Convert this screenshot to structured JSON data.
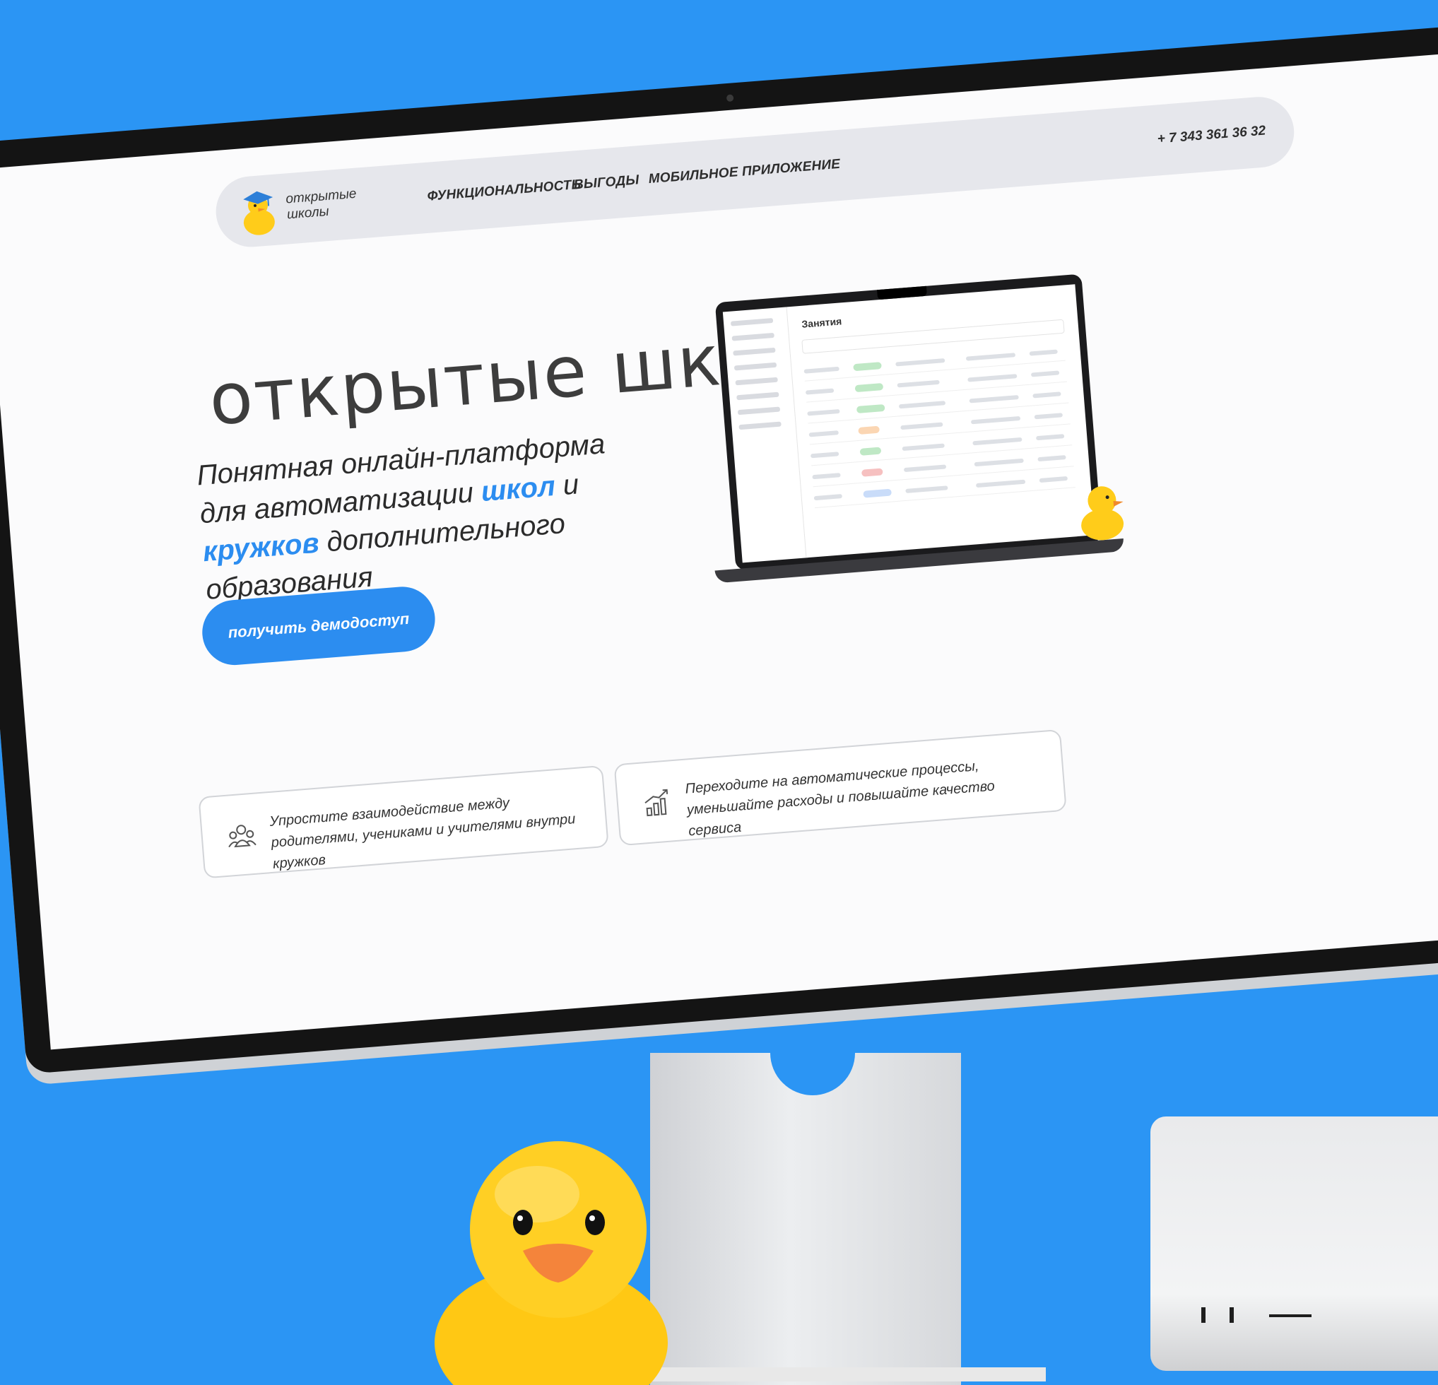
{
  "header": {
    "logo_line1": "ОТКРЫТЫЕ",
    "logo_line2": "ШКОЛЫ",
    "nav": [
      {
        "label": "ФУНКЦИОНАЛЬНОСТЬ"
      },
      {
        "label": "ВЫГОДЫ"
      },
      {
        "label": "МОБИЛЬНОЕ ПРИЛОЖЕНИЕ"
      }
    ],
    "phone": "+ 7 343 361 36 32"
  },
  "hero": {
    "title": "ОТКРЫТЫЕ ШКОЛЫ",
    "subtitle_part1": "Понятная онлайн-платформа для автоматизации ",
    "subtitle_accent1": "школ",
    "subtitle_and": " и ",
    "subtitle_accent2": "кружков",
    "subtitle_part2": " дополнительного образования",
    "cta_label": "ПОЛУЧИТЬ ДЕМОДОСТУП"
  },
  "mockup": {
    "title": "Занятия"
  },
  "features": [
    {
      "icon": "people-icon",
      "text": "Упростите взаимодействие между родителями, учениками и учителями внутри кружков"
    },
    {
      "icon": "growth-chart-icon",
      "text": "Переходите на автоматические процессы, уменьшайте расходы и повышайте качество сервиса"
    }
  ],
  "colors": {
    "background": "#2b95f4",
    "accent": "#2c8df0",
    "nav_bg": "#e6e7ec",
    "duck_yellow": "#ffcc1a"
  }
}
